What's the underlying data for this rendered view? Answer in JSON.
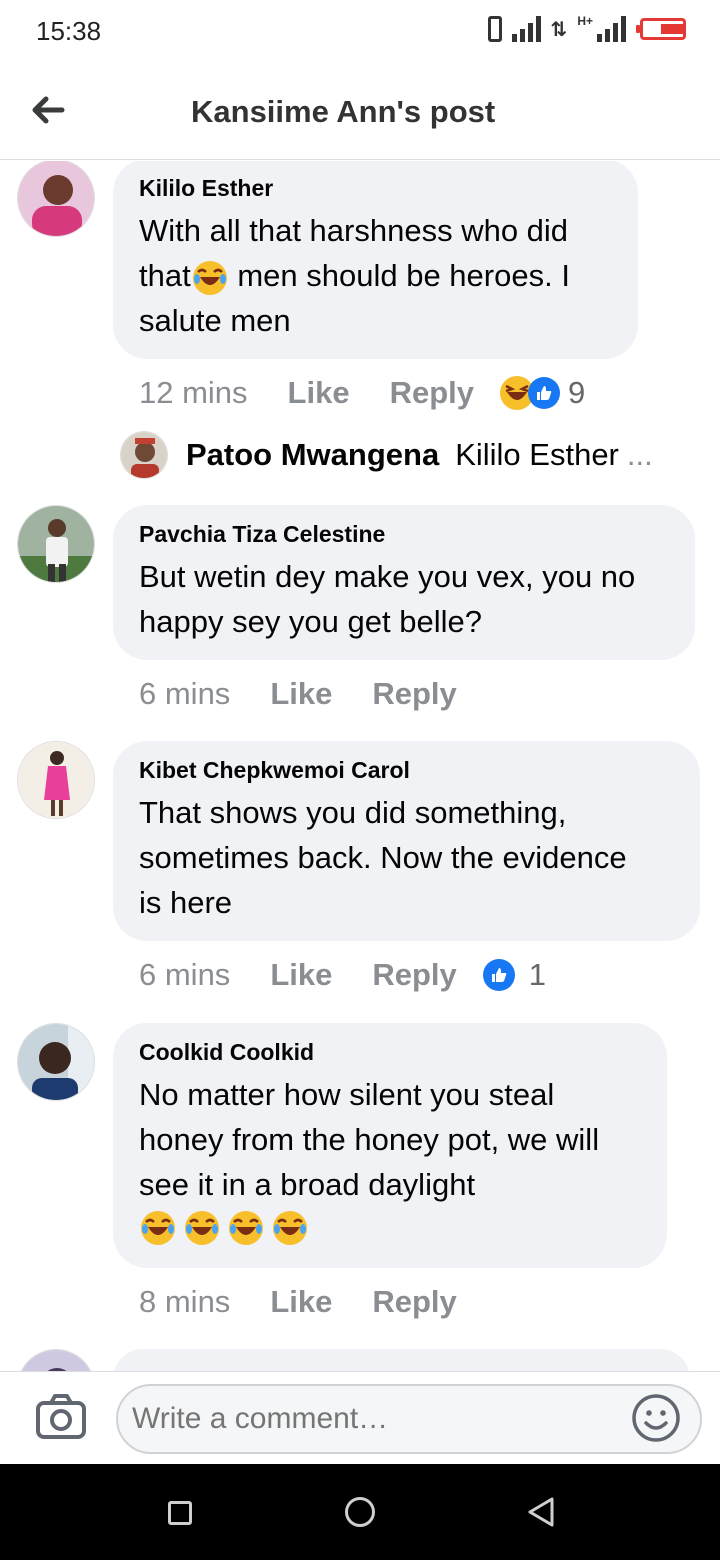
{
  "status_bar": {
    "time": "15:38",
    "network_label": "H+"
  },
  "header": {
    "title": "Kansiime Ann's post"
  },
  "comments": [
    {
      "author": "Kililo Esther",
      "text_lines": [
        "With all that harshness who did",
        "that",
        " men should be heroes. I",
        "salute men"
      ],
      "time": "12 mins",
      "like_label": "Like",
      "reply_label": "Reply",
      "reactions": [
        "laugh",
        "like"
      ],
      "reaction_count": "9"
    },
    {
      "author": "Pavchia Tiza Celestine",
      "text_lines": [
        "But wetin dey make you vex, you no",
        "happy sey you get belle?"
      ],
      "time": "6 mins",
      "like_label": "Like",
      "reply_label": "Reply"
    },
    {
      "author": "Kibet Chepkwemoi Carol",
      "text_lines": [
        "That shows you did something,",
        "sometimes back. Now the evidence",
        "is here"
      ],
      "time": "6 mins",
      "like_label": "Like",
      "reply_label": "Reply",
      "reactions": [
        "like"
      ],
      "reaction_count": "1"
    },
    {
      "author": "Coolkid Coolkid",
      "text_lines": [
        "No matter how silent you steal",
        "honey from the honey pot, we will",
        "see it in a broad daylight"
      ],
      "time": "8 mins",
      "like_label": "Like",
      "reply_label": "Reply"
    }
  ],
  "reply_preview": {
    "name": "Patoo Mwangena",
    "text": "Kililo Esther",
    "ellipsis": "..."
  },
  "composer": {
    "placeholder": "Write a comment…"
  },
  "colors": {
    "accent": "#1877f2",
    "bubble": "#f0f2f5",
    "battery": "#e53935"
  },
  "icons": [
    "back-arrow-icon",
    "camera-icon",
    "smile-icon",
    "laughing-emoji-icon",
    "like-icon",
    "nav-recents-icon",
    "nav-home-icon",
    "nav-back-icon"
  ]
}
